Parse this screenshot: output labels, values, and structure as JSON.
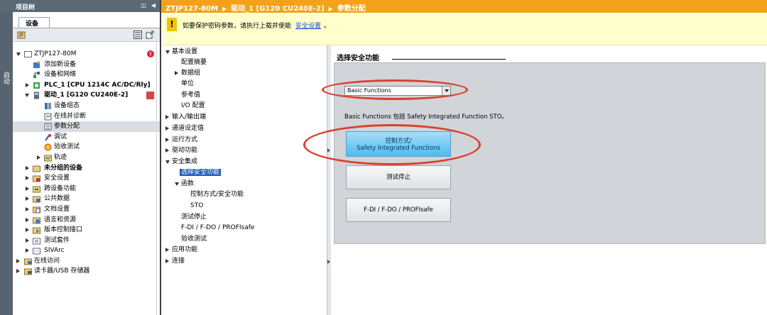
{
  "project_tree": {
    "header": "项目树",
    "side_label": "启动",
    "tab": "设备",
    "items": [
      {
        "label": "ZTJP127-80M"
      },
      {
        "label": "添加新设备"
      },
      {
        "label": "设备和网络"
      },
      {
        "label": "PLC_1 [CPU 1214C AC/DC/Rly]"
      },
      {
        "label": "驱动_1 [G120 CU240E-2]"
      },
      {
        "label": "设备组态"
      },
      {
        "label": "在线并诊断"
      },
      {
        "label": "参数分配"
      },
      {
        "label": "调试"
      },
      {
        "label": "验收测试"
      },
      {
        "label": "轨迹"
      },
      {
        "label": "未分组的设备"
      },
      {
        "label": "安全设置"
      },
      {
        "label": "跨设备功能"
      },
      {
        "label": "公共数据"
      },
      {
        "label": "文档设置"
      },
      {
        "label": "语言和资源"
      },
      {
        "label": "版本控制接口"
      },
      {
        "label": "测试套件"
      },
      {
        "label": "SIVArc"
      },
      {
        "label": "在线访问"
      },
      {
        "label": "读卡器/USB 存储器"
      }
    ]
  },
  "breadcrumb": {
    "items": [
      "ZTJP127-80M",
      "驱动_1 [G120 CU240E-2]",
      "参数分配"
    ]
  },
  "info": {
    "icon": "!",
    "text": "如要保护密码参数，请执行上载并使能",
    "link": "安全设置",
    "suffix": "。"
  },
  "nav": {
    "items": [
      {
        "label": "基本设置"
      },
      {
        "label": "配置摘要"
      },
      {
        "label": "数据组"
      },
      {
        "label": "单位"
      },
      {
        "label": "参考值"
      },
      {
        "label": "I/O 配置"
      },
      {
        "label": "输入/输出端"
      },
      {
        "label": "通道设定值"
      },
      {
        "label": "运行方式"
      },
      {
        "label": "驱动功能"
      },
      {
        "label": "安全集成"
      },
      {
        "label": "选择安全功能"
      },
      {
        "label": "函数"
      },
      {
        "label": "控制方式/安全功能"
      },
      {
        "label": "STO"
      },
      {
        "label": "测试停止"
      },
      {
        "label": "F-DI / F-DO / PROFIsafe"
      },
      {
        "label": "验收测试"
      },
      {
        "label": "应用功能"
      },
      {
        "label": "连接"
      }
    ]
  },
  "main": {
    "title": "选择安全功能",
    "select_value": "Basic Functions",
    "description": "Basic Functions 包括 Safety Integrated Function STO。",
    "buttons": {
      "control_line1": "控制方式/",
      "control_line2": "Safety Integrated Functions",
      "test_stop": "测试停止",
      "fdi": "F-DI / F-DO / PROFIsafe"
    }
  },
  "colors": {
    "breadcrumb_bg": "#f4a21a",
    "info_bg": "#ffffcc",
    "highlight": "#d8432c",
    "selection": "#1e5db8"
  }
}
